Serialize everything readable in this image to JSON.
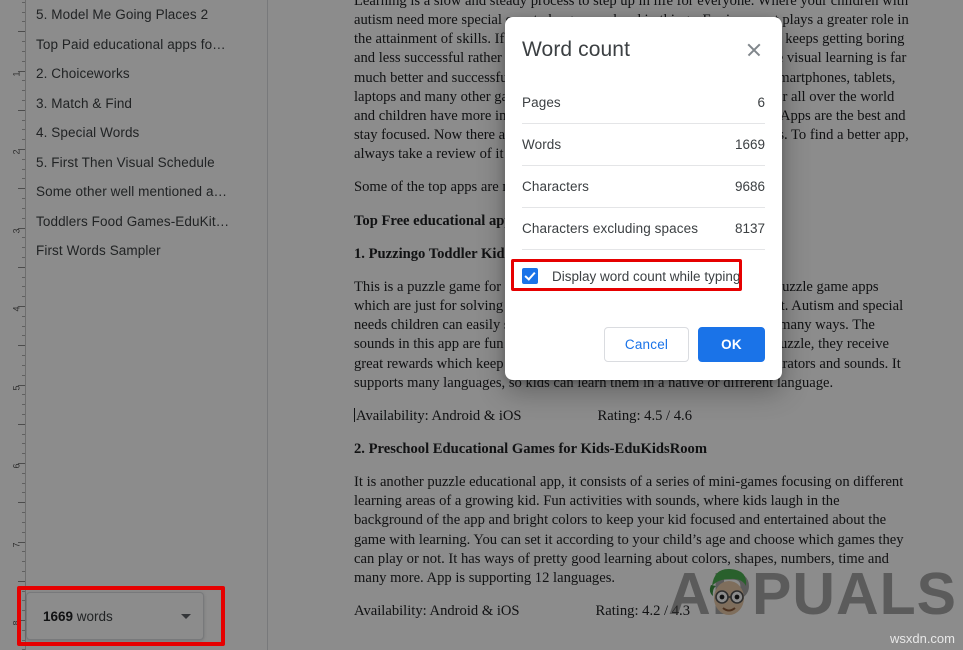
{
  "ruler": {
    "numbers": [
      "1",
      "2",
      "3",
      "4",
      "5",
      "6",
      "7",
      "8"
    ]
  },
  "sidebar": {
    "outline_items": [
      {
        "label": "5. Model Me Going Places 2"
      },
      {
        "label": "Top Paid educational apps fo…"
      },
      {
        "label": "2. Choiceworks"
      },
      {
        "label": "3. Match & Find"
      },
      {
        "label": "4. Special Words"
      },
      {
        "label": "5. First Then Visual Schedule"
      },
      {
        "label": "Some other well mentioned a…"
      },
      {
        "label": "Toddlers Food Games-EduKit…"
      },
      {
        "label": "First Words Sampler"
      }
    ]
  },
  "word_count_chip": {
    "count": "1669",
    "unit": " words",
    "caret_icon": "chevron-down-icon"
  },
  "document": {
    "paragraphs": [
      {
        "type": "paragraph",
        "text": "Learning is a slow and steady process to step up in life for everyone. Where your children with autism need more special care to be grown ahead in things. Environment plays a greater role in the attainment of skills. If your child is not getting interest in studies, and keeps getting boring and less successful rather than other students of the class. In this case, the visual learning is far much better and successful than the other ways of learning. Nowadays, smartphones, tablets, laptops and many other gadgets are running with different applications for all over the world and children have more interest in these things to have a few years back. Apps are the best and stay focused. Now there are thousands of applications of various qualities. To find a better app, always take a review of it before trying."
      },
      {
        "type": "paragraph",
        "text": "Some of the top apps are mentioned below."
      },
      {
        "type": "heading",
        "text": "Top Free educational apps for kids with autism"
      },
      {
        "type": "heading",
        "text": "1. Puzzingo Toddler Kids Puzzles"
      },
      {
        "type": "paragraph",
        "text": "This is a puzzle game for kids with autism; it is different from the other puzzle game apps which are just for solving a puzzle in a certain way and nothing more in it. Autism and special needs children can easily solve and enjoy these puzzles, helping them in many ways. The sounds in this app are fun for kids to listen to. Upon each finishing of a puzzle, they receive great rewards which keep them carry on. They use professionals for illustrators and sounds. It supports many languages, so kids can learn them in a native or different language."
      },
      {
        "type": "availability",
        "availability": "Availability: Android & iOS",
        "rating": "Rating: 4.5 / 4.6"
      },
      {
        "type": "heading",
        "text": "2. Preschool Educational Games for Kids-EduKidsRoom"
      },
      {
        "type": "paragraph",
        "text": "It is another puzzle educational app, it consists of a series of mini-games focusing on different learning areas of a growing kid. Fun activities with sounds, where kids laugh in the background of the app and bright colors to keep your kid focused and entertained about the game with learning. You can set it according to your child’s age and choose which games they can play or not. It has ways of pretty good learning about colors, shapes, numbers, time and many more. App is supporting 12 languages."
      },
      {
        "type": "availability",
        "availability": "Availability: Android & iOS",
        "rating": "Rating: 4.2 / 4.3"
      }
    ]
  },
  "dialog": {
    "title": "Word count",
    "close_icon": "close-icon",
    "stats": [
      {
        "label": "Pages",
        "value": "6"
      },
      {
        "label": "Words",
        "value": "1669"
      },
      {
        "label": "Characters",
        "value": "9686"
      },
      {
        "label": "Characters excluding spaces",
        "value": "8137"
      }
    ],
    "checkbox": {
      "label": "Display word count while typing",
      "checked": true
    },
    "buttons": {
      "cancel": "Cancel",
      "ok": "OK"
    }
  },
  "watermark": {
    "brand": "APPUALS",
    "site": "wsxdn.com"
  },
  "colors": {
    "accent_blue": "#1a73e8",
    "highlight_red": "#e60000",
    "text_primary": "#3c4043"
  }
}
